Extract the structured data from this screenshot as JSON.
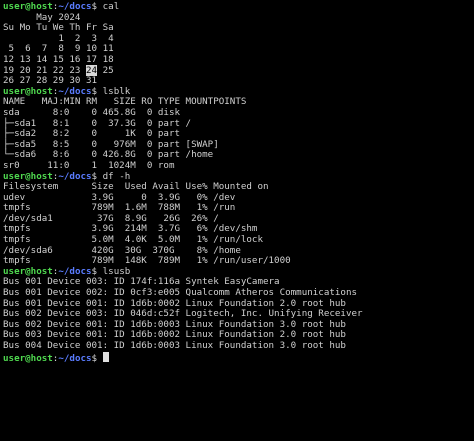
{
  "prompt": {
    "user": "user@host",
    "sep": ":",
    "path": "~/docs",
    "sym": "$ "
  },
  "cal": {
    "cmd": "cal",
    "lines": [
      "      May 2024",
      "Su Mo Tu We Th Fr Sa",
      "          1  2  3  4",
      " 5  6  7  8  9 10 11",
      "12 13 14 15 16 17 18"
    ],
    "today_row_pre": "19 20 21 22 23 ",
    "today": "24",
    "today_row_post": " 25",
    "last": "26 27 28 29 30 31"
  },
  "lsblk": {
    "cmd": "lsblk",
    "lines": [
      "NAME   MAJ:MIN RM   SIZE RO TYPE MOUNTPOINTS",
      "sda      8:0    0 465.8G  0 disk",
      "├─sda1   8:1    0  37.3G  0 part /",
      "├─sda2   8:2    0     1K  0 part",
      "├─sda5   8:5    0   976M  0 part [SWAP]",
      "└─sda6   8:6    0 426.8G  0 part /home",
      "sr0     11:0    1  1024M  0 rom"
    ]
  },
  "df": {
    "cmd": "df -h",
    "lines": [
      "Filesystem      Size  Used Avail Use% Mounted on",
      "udev            3.9G     0  3.9G   0% /dev",
      "tmpfs           789M  1.6M  788M   1% /run",
      "/dev/sda1        37G  8.9G   26G  26% /",
      "tmpfs           3.9G  214M  3.7G   6% /dev/shm",
      "tmpfs           5.0M  4.0K  5.0M   1% /run/lock",
      "/dev/sda6       420G  30G  370G    8% /home",
      "tmpfs           789M  148K  789M   1% /run/user/1000"
    ]
  },
  "lsusb": {
    "cmd": "lsusb",
    "lines": [
      "Bus 001 Device 003: ID 174f:116a Syntek EasyCamera",
      "Bus 001 Device 002: ID 0cf3:e005 Qualcomm Atheros Communications",
      "Bus 001 Device 001: ID 1d6b:0002 Linux Foundation 2.0 root hub",
      "Bus 002 Device 003: ID 046d:c52f Logitech, Inc. Unifying Receiver",
      "Bus 002 Device 001: ID 1d6b:0003 Linux Foundation 3.0 root hub",
      "Bus 003 Device 001: ID 1d6b:0002 Linux Foundation 2.0 root hub",
      "Bus 004 Device 001: ID 1d6b:0003 Linux Foundation 3.0 root hub"
    ]
  }
}
